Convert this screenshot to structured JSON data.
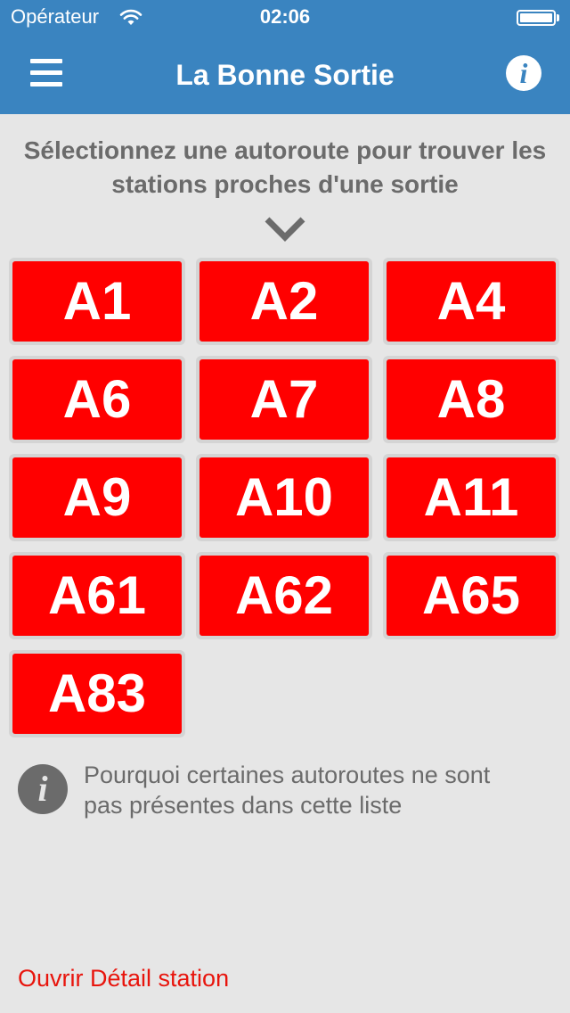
{
  "status_bar": {
    "carrier": "Opérateur",
    "time": "02:06",
    "battery_level": 1.0
  },
  "nav_bar": {
    "title": "La Bonne Sortie",
    "menu_icon": "hamburger-menu-icon",
    "info_icon": "info-icon",
    "info_glyph": "i"
  },
  "instruction": {
    "text": "Sélectionnez une autoroute pour trouver les stations proches d'une sortie",
    "icon": "chevron-down-icon"
  },
  "highways": [
    "A1",
    "A2",
    "A4",
    "A6",
    "A7",
    "A8",
    "A9",
    "A10",
    "A11",
    "A61",
    "A62",
    "A65",
    "A83"
  ],
  "missing_info": {
    "icon": "info-icon",
    "glyph": "i",
    "text": "Pourquoi certaines autoroutes ne sont pas présentes dans cette liste"
  },
  "footer": {
    "link_label": "Ouvrir Détail station"
  },
  "colors": {
    "nav_bar": "#3a84c0",
    "background": "#e6e6e6",
    "tile": "#ff0000",
    "tile_text": "#ffffff",
    "muted_text": "#6b6b6b",
    "link": "#e8150d"
  }
}
